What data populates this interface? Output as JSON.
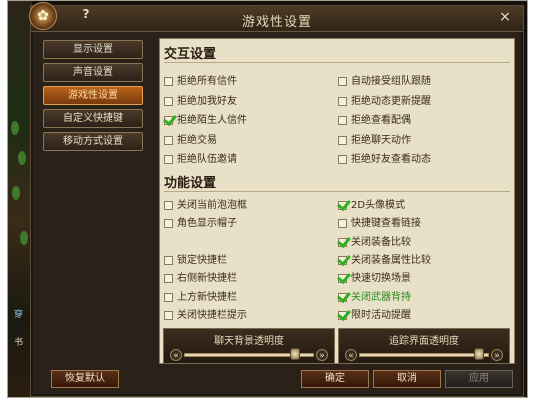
{
  "window": {
    "title": "游戏性设置",
    "help": "?",
    "close": "×"
  },
  "world_text": [
    "穿",
    "书"
  ],
  "nav": {
    "items": [
      {
        "label": "显示设置",
        "active": false
      },
      {
        "label": "声音设置",
        "active": false
      },
      {
        "label": "游戏性设置",
        "active": true
      },
      {
        "label": "自定义快捷键",
        "active": false
      },
      {
        "label": "移动方式设置",
        "active": false
      }
    ]
  },
  "interaction": {
    "title": "交互设置",
    "left": [
      {
        "label": "拒绝所有信件",
        "checked": false
      },
      {
        "label": "拒绝加我好友",
        "checked": false
      },
      {
        "label": "拒绝陌生人信件",
        "checked": true
      },
      {
        "label": "拒绝交易",
        "checked": false
      },
      {
        "label": "拒绝队伍邀请",
        "checked": false
      }
    ],
    "right": [
      {
        "label": "自动接受组队跟随",
        "checked": false
      },
      {
        "label": "拒绝动态更新提醒",
        "checked": false
      },
      {
        "label": "拒绝查看配偶",
        "checked": false
      },
      {
        "label": "拒绝聊天动作",
        "checked": false
      },
      {
        "label": "拒绝好友查看动态",
        "checked": false
      }
    ]
  },
  "function": {
    "title": "功能设置",
    "left": [
      {
        "label": "关闭当前泡泡框",
        "checked": false,
        "row": 0
      },
      {
        "label": "角色显示帽子",
        "checked": false,
        "row": 1
      },
      {
        "label": "锁定快捷栏",
        "checked": false,
        "row": 3
      },
      {
        "label": "右侧新快捷栏",
        "checked": false,
        "row": 4
      },
      {
        "label": "上方新快捷栏",
        "checked": false,
        "row": 5
      },
      {
        "label": "关闭快捷栏提示",
        "checked": false,
        "row": 6
      }
    ],
    "right": [
      {
        "label": "2D头像模式",
        "checked": true,
        "green": false
      },
      {
        "label": "快捷键查看链接",
        "checked": false,
        "green": false
      },
      {
        "label": "关闭装备比较",
        "checked": true,
        "green": false
      },
      {
        "label": "关闭装备属性比较",
        "checked": true,
        "green": false
      },
      {
        "label": "快速切换场景",
        "checked": true,
        "green": false
      },
      {
        "label": "关闭武器背持",
        "checked": true,
        "green": true
      },
      {
        "label": "限时活动提醒",
        "checked": true,
        "green": false
      }
    ]
  },
  "sliders": [
    {
      "label": "聊天背景透明度",
      "level": 0.85
    },
    {
      "label": "追踪界面透明度",
      "level": 0.92
    }
  ],
  "buttons": {
    "reset": "恢复默认",
    "ok": "确定",
    "cancel": "取消",
    "apply": "应用"
  }
}
